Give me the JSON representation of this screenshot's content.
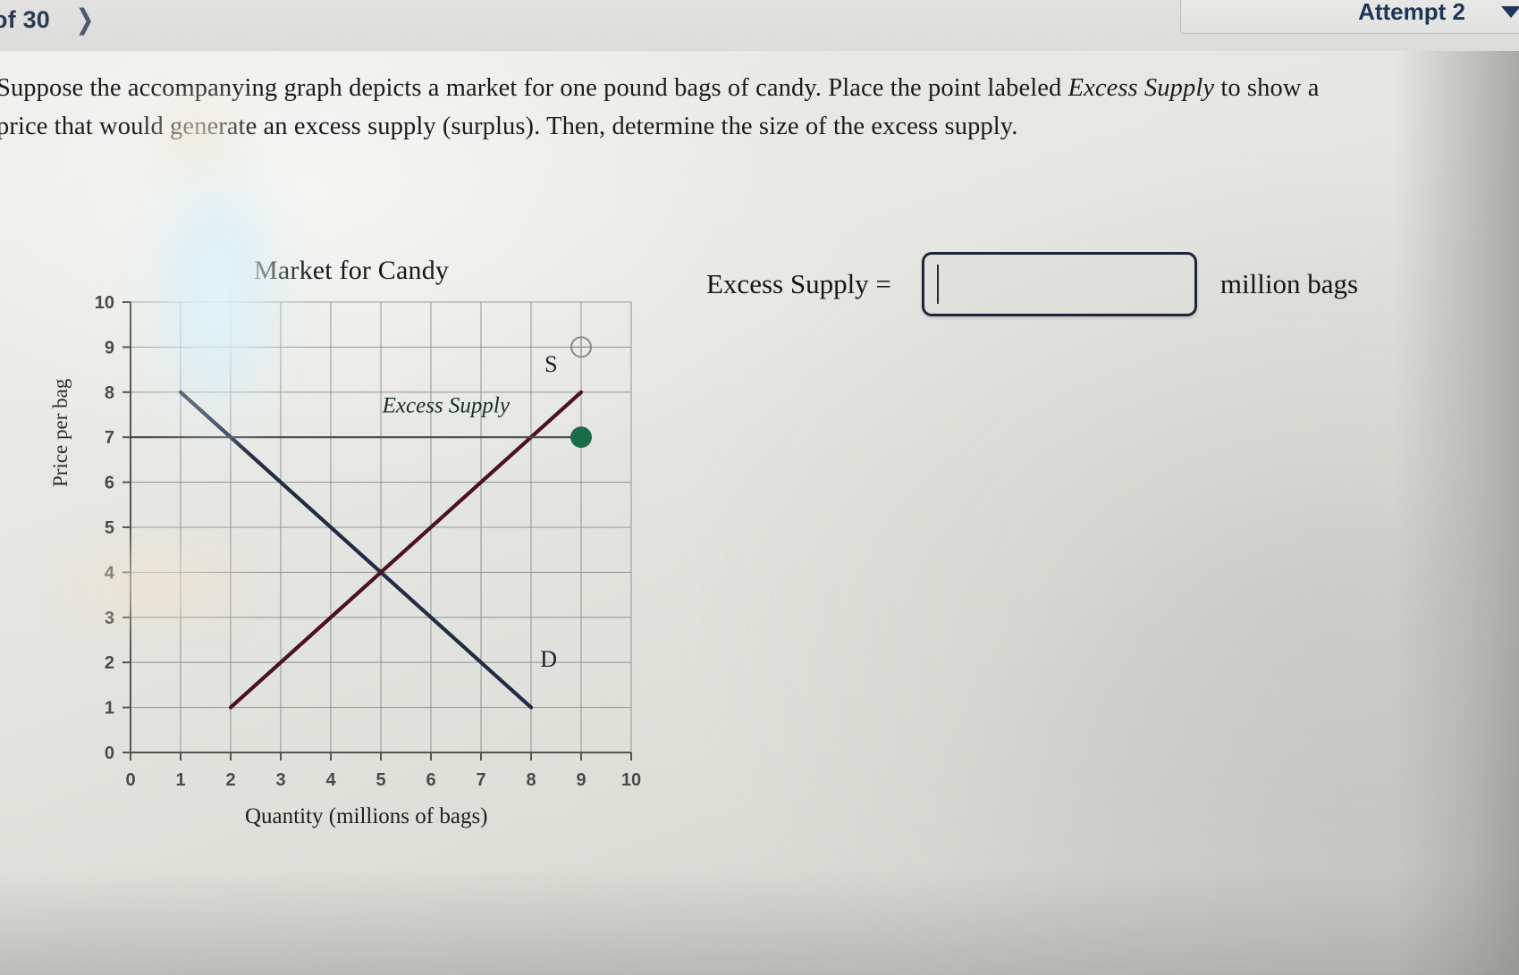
{
  "topbar": {
    "pagination_text": "of 30",
    "next_icon": "chevron-right-icon",
    "attempt_label": "Attempt 2",
    "caret_icon": "chevron-down-icon"
  },
  "prompt": {
    "part1": "Suppose the accompanying graph depicts a market for one pound bags of candy. Place the point labeled ",
    "emphasis": "Excess Supply",
    "part2": " to show a price that would generate an excess supply (surplus). Then, determine the size of the excess supply."
  },
  "answer": {
    "label": "Excess Supply =",
    "value": "",
    "placeholder": "",
    "unit": "million bags"
  },
  "chart_data": {
    "type": "line",
    "title": "Market for Candy",
    "xlabel": "Quantity (millions of bags)",
    "ylabel": "Price per bag",
    "xlim": [
      0,
      10
    ],
    "ylim": [
      0,
      10
    ],
    "xticks": [
      "0",
      "1",
      "2",
      "3",
      "4",
      "5",
      "6",
      "7",
      "8",
      "9",
      "10"
    ],
    "yticks": [
      "0",
      "1",
      "2",
      "3",
      "4",
      "5",
      "6",
      "7",
      "8",
      "9",
      "10"
    ],
    "grid": true,
    "legend_position": "inline-labels",
    "series": [
      {
        "name": "D",
        "label": "D",
        "color": "#1f2b47",
        "points": [
          [
            1,
            8
          ],
          [
            8,
            1
          ]
        ],
        "label_at": [
          8.35,
          1.9
        ]
      },
      {
        "name": "S",
        "label": "S",
        "color": "#4a1024",
        "points": [
          [
            2,
            1
          ],
          [
            9,
            8
          ]
        ],
        "label_at": [
          8.4,
          8.45
        ]
      },
      {
        "name": "price-line",
        "label": "",
        "color": "#4a4a4a",
        "points": [
          [
            0,
            7
          ],
          [
            9,
            7
          ]
        ]
      }
    ],
    "annotations": [
      {
        "name": "excess-supply-point",
        "text": "Excess Supply",
        "marker": "filled-circle",
        "color": "#1a6b4a",
        "x": 9,
        "y": 7,
        "label_at": [
          6.3,
          7.55
        ]
      },
      {
        "name": "open-circle-marker",
        "text": "",
        "marker": "open-circle",
        "color": "#8a8a88",
        "x": 9,
        "y": 9
      }
    ],
    "equilibrium": {
      "x": 4.5,
      "y": 4
    }
  }
}
